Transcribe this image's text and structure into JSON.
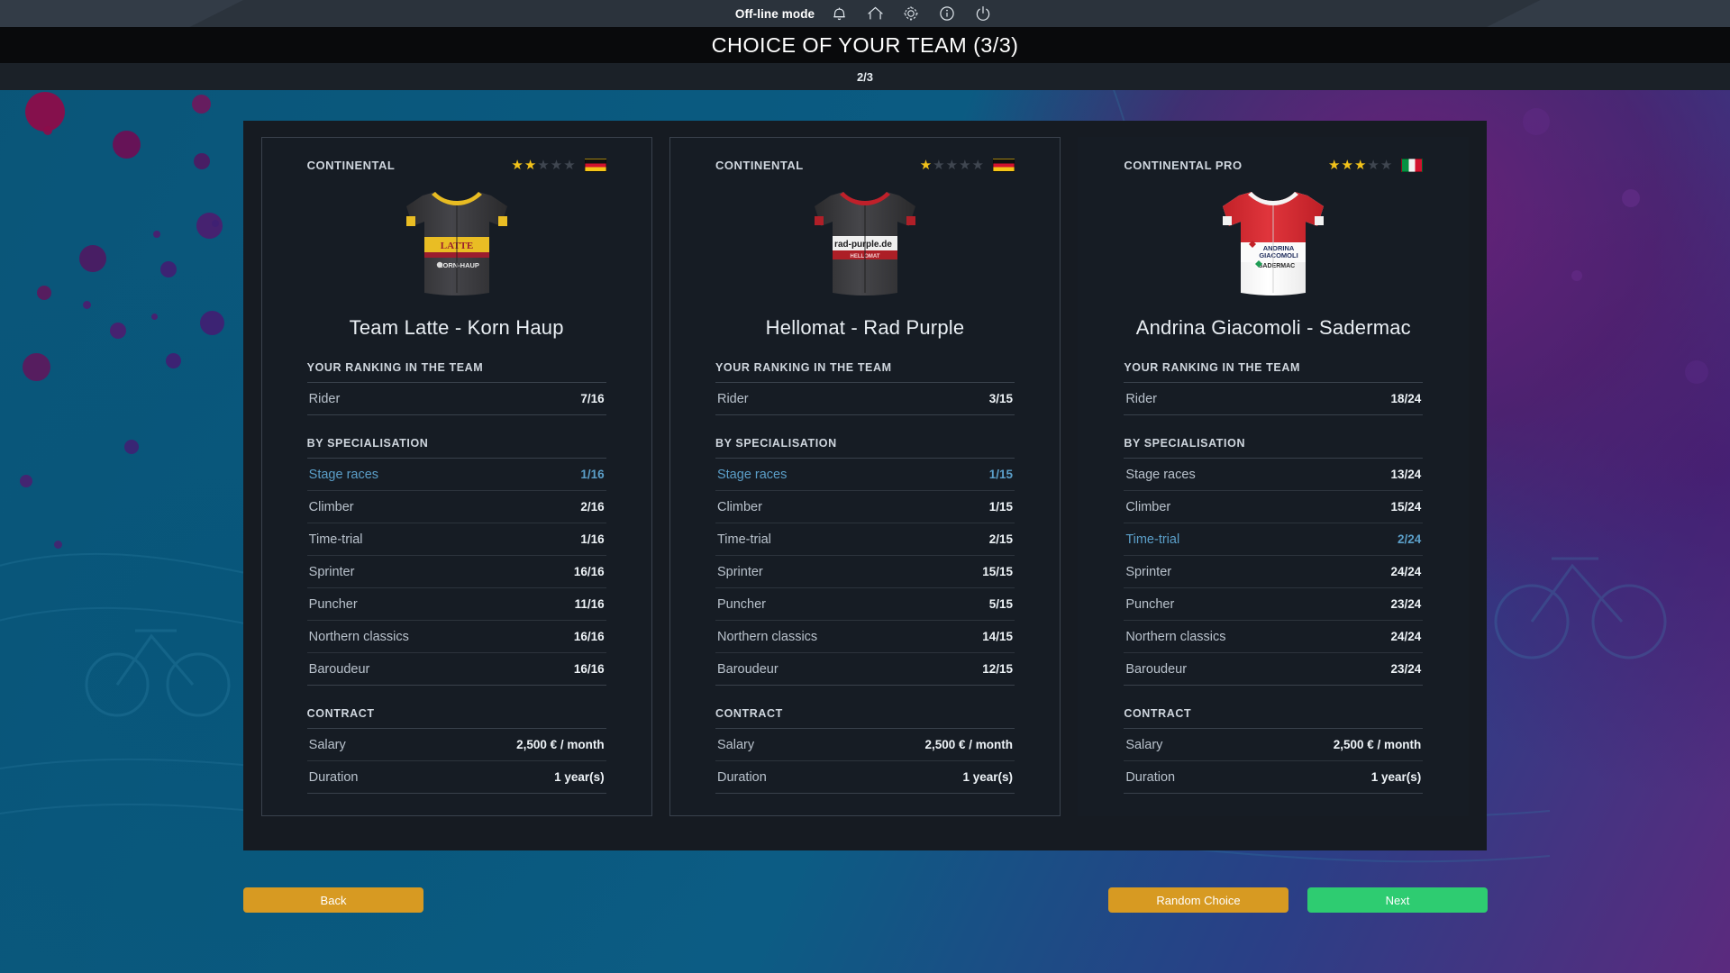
{
  "topbar": {
    "offline_label": "Off-line mode",
    "icons": [
      {
        "name": "bell-icon",
        "label": "Notifications"
      },
      {
        "name": "home-icon",
        "label": "Home"
      },
      {
        "name": "gear-icon",
        "label": "Settings"
      },
      {
        "name": "info-icon",
        "label": "Information"
      },
      {
        "name": "power-icon",
        "label": "Quit"
      }
    ]
  },
  "header": {
    "title": "CHOICE OF YOUR TEAM (3/3)",
    "page_indicator": "2/3"
  },
  "sections": {
    "ranking_title": "YOUR RANKING IN THE TEAM",
    "specialisation_title": "BY SPECIALISATION",
    "contract_title": "CONTRACT",
    "rider_label": "Rider",
    "salary_label": "Salary",
    "duration_label": "Duration"
  },
  "colors": {
    "highlight": "#5b9fc9",
    "star_on": "#f2c21a",
    "star_off": "#3f4650",
    "btn_orange": "#d79a22",
    "btn_green": "#2ecc71",
    "card_bg": "#161c24",
    "panel_bg": "#161b22"
  },
  "cards": [
    {
      "category": "CONTINENTAL",
      "stars": 2,
      "stars_total": 5,
      "flag": "de",
      "jersey": "latte-korn-haup-jersey",
      "team_name": "Team Latte - Korn Haup",
      "rider_rank": "7/16",
      "specialisations": [
        {
          "label": "Stage races",
          "value": "1/16",
          "highlight": true
        },
        {
          "label": "Climber",
          "value": "2/16",
          "highlight": false
        },
        {
          "label": "Time-trial",
          "value": "1/16",
          "highlight": false
        },
        {
          "label": "Sprinter",
          "value": "16/16",
          "highlight": false
        },
        {
          "label": "Puncher",
          "value": "11/16",
          "highlight": false
        },
        {
          "label": "Northern classics",
          "value": "16/16",
          "highlight": false
        },
        {
          "label": "Baroudeur",
          "value": "16/16",
          "highlight": false
        }
      ],
      "salary": "2,500 € / month",
      "duration": "1 year(s)"
    },
    {
      "category": "CONTINENTAL",
      "stars": 1,
      "stars_total": 5,
      "flag": "de",
      "jersey": "rad-purple-jersey",
      "team_name": "Hellomat - Rad Purple",
      "rider_rank": "3/15",
      "specialisations": [
        {
          "label": "Stage races",
          "value": "1/15",
          "highlight": true
        },
        {
          "label": "Climber",
          "value": "1/15",
          "highlight": false
        },
        {
          "label": "Time-trial",
          "value": "2/15",
          "highlight": false
        },
        {
          "label": "Sprinter",
          "value": "15/15",
          "highlight": false
        },
        {
          "label": "Puncher",
          "value": "5/15",
          "highlight": false
        },
        {
          "label": "Northern classics",
          "value": "14/15",
          "highlight": false
        },
        {
          "label": "Baroudeur",
          "value": "12/15",
          "highlight": false
        }
      ],
      "salary": "2,500 € / month",
      "duration": "1 year(s)"
    },
    {
      "category": "CONTINENTAL PRO",
      "stars": 3,
      "stars_total": 5,
      "flag": "it",
      "jersey": "andrina-giacomoli-jersey",
      "team_name": "Andrina Giacomoli - Sadermac",
      "rider_rank": "18/24",
      "specialisations": [
        {
          "label": "Stage races",
          "value": "13/24",
          "highlight": false
        },
        {
          "label": "Climber",
          "value": "15/24",
          "highlight": false
        },
        {
          "label": "Time-trial",
          "value": "2/24",
          "highlight": true
        },
        {
          "label": "Sprinter",
          "value": "24/24",
          "highlight": false
        },
        {
          "label": "Puncher",
          "value": "23/24",
          "highlight": false
        },
        {
          "label": "Northern classics",
          "value": "24/24",
          "highlight": false
        },
        {
          "label": "Baroudeur",
          "value": "23/24",
          "highlight": false
        }
      ],
      "salary": "2,500 € / month",
      "duration": "1 year(s)"
    }
  ],
  "footer": {
    "back_label": "Back",
    "random_label": "Random Choice",
    "next_label": "Next"
  }
}
